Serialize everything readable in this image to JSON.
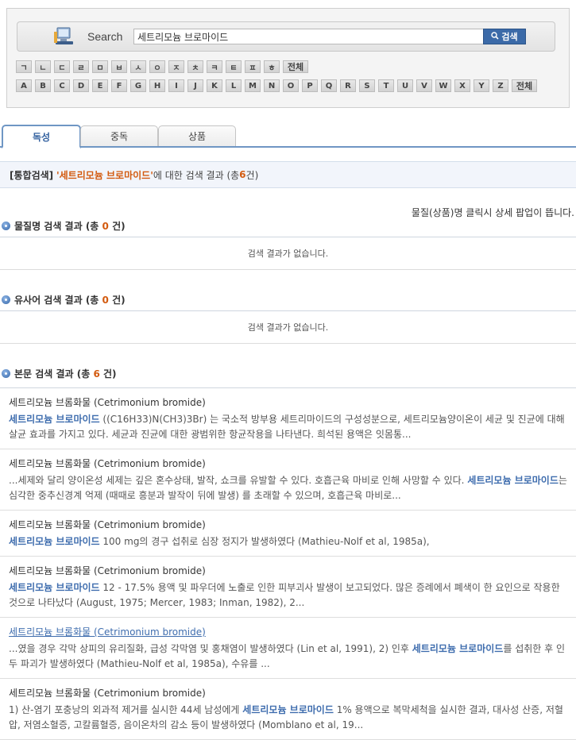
{
  "search": {
    "label": "Search",
    "value": "세트리모늄 브로마이드",
    "button_label": "검색"
  },
  "keys": {
    "korean": [
      "ㄱ",
      "ㄴ",
      "ㄷ",
      "ㄹ",
      "ㅁ",
      "ㅂ",
      "ㅅ",
      "ㅇ",
      "ㅈ",
      "ㅊ",
      "ㅋ",
      "ㅌ",
      "ㅍ",
      "ㅎ",
      "전체"
    ],
    "latin": [
      "A",
      "B",
      "C",
      "D",
      "E",
      "F",
      "G",
      "H",
      "I",
      "J",
      "K",
      "L",
      "M",
      "N",
      "O",
      "P",
      "Q",
      "R",
      "S",
      "T",
      "U",
      "V",
      "W",
      "X",
      "Y",
      "Z",
      "전체"
    ]
  },
  "tabs": [
    {
      "label": "독성",
      "active": true
    },
    {
      "label": "중독",
      "active": false
    },
    {
      "label": "상품",
      "active": false
    }
  ],
  "summary": {
    "tag": "[통합검색]",
    "keyword": "'세트리모늄 브로마이드'",
    "text_mid": " 에 대한 검색 결과 (총 ",
    "count": "6",
    "text_end": " 건)"
  },
  "popup_note": "물질(상품)명 클릭시 상세 팝업이 뜹니다.",
  "sections": {
    "substance": {
      "label": "물질명 검색 결과 (총 ",
      "count": "0",
      "suffix": " 건)",
      "empty": "검색 결과가 없습니다."
    },
    "synonym": {
      "label": "유사어 검색 결과 (총 ",
      "count": "0",
      "suffix": " 건)",
      "empty": "검색 결과가 없습니다."
    },
    "body": {
      "label": "본문 검색 결과 (총 ",
      "count": "6",
      "suffix": " 건)"
    }
  },
  "results": [
    {
      "title": "세트리모늄 브롬화물 (Cetrimonium bromide)",
      "link": false,
      "parts": [
        {
          "t": "세트리모늄 브로마이드",
          "h": true
        },
        {
          "t": " ((C16H33)N(CH3)3Br) 는 국소적 방부용 세트리마이드의 구성성분으로, 세트리모늄양이온이 세균 및 진균에 대해 살균 효과를 가지고 있다. 세균과 진균에 대한 광범위한 항균작용을 나타낸다. 희석된 용액은 잇몸통...",
          "h": false
        }
      ]
    },
    {
      "title": "세트리모늄 브롬화물 (Cetrimonium bromide)",
      "link": false,
      "parts": [
        {
          "t": "...세제와 달리 양이온성 세제는 깊은 혼수상태, 발작, 쇼크를 유발할 수 있다. 호흡근육 마비로 인해 사망할 수 있다. ",
          "h": false
        },
        {
          "t": "세트리모늄 브로마이드",
          "h": true
        },
        {
          "t": "는 심각한 중추신경계 억제 (때때로 흥분과 발작이 뒤에 발생) 를 초래할 수 있으며, 호흡근육 마비로...",
          "h": false
        }
      ]
    },
    {
      "title": "세트리모늄 브롬화물 (Cetrimonium bromide)",
      "link": false,
      "parts": [
        {
          "t": "세트리모늄 브로마이드",
          "h": true
        },
        {
          "t": " 100 mg의 경구 섭취로 심장 정지가 발생하였다 (Mathieu-Nolf et al, 1985a),",
          "h": false
        }
      ]
    },
    {
      "title": "세트리모늄 브롬화물 (Cetrimonium bromide)",
      "link": false,
      "parts": [
        {
          "t": "세트리모늄 브로마이드",
          "h": true
        },
        {
          "t": " 12 - 17.5% 용액 및 파우더에 노출로 인한 피부괴사 발생이 보고되었다. 많은 증례에서 폐색이 한 요인으로 작용한 것으로 나타났다 (August, 1975; Mercer, 1983; Inman, 1982), 2...",
          "h": false
        }
      ]
    },
    {
      "title": "세트리모늄 브롬화물 (Cetrimonium bromide)",
      "link": true,
      "parts": [
        {
          "t": "...였을 경우 각막 상피의 유리질화, 급성 각막염 및 홍채염이 발생하였다 (Lin et al, 1991), 2) 인후 ",
          "h": false
        },
        {
          "t": "세트리모늄 브로마이드",
          "h": true
        },
        {
          "t": "를 섭취한 후 인두 파괴가 발생하였다 (Mathieu-Nolf et al, 1985a), 수유를 ...",
          "h": false
        }
      ]
    },
    {
      "title": "세트리모늄 브롬화물 (Cetrimonium bromide)",
      "link": false,
      "parts": [
        {
          "t": "1) 산-염기 포충낭의 외과적 제거를 실시한 44세 남성에게 ",
          "h": false
        },
        {
          "t": "세트리모늄 브로마이드",
          "h": true
        },
        {
          "t": " 1% 용액으로 복막세척을 실시한 결과, 대사성 산증, 저혈압, 저염소혈증, 고칼륨혈증, 음이온차의 감소 등이 발생하였다 (Momblano et al, 19...",
          "h": false
        }
      ]
    }
  ]
}
